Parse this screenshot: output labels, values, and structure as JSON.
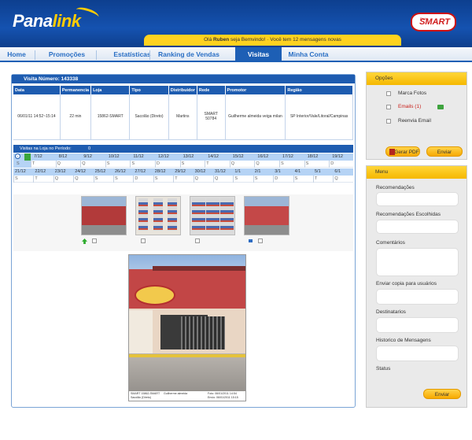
{
  "header": {
    "logo_main": "Pana",
    "logo_accent": "link",
    "brand_small": "Rede",
    "brand_name": "SMART",
    "welcome_prefix": "Olá ",
    "welcome_user": "Ruben",
    "welcome_suffix": " seja Bemvindo! · Você tem 12 mensagens novas"
  },
  "nav": [
    {
      "label": "Home"
    },
    {
      "label": "Promoções"
    },
    {
      "label": "Estatísticas"
    },
    {
      "label": "Ranking de Vendas"
    },
    {
      "label": "Visitas",
      "active": true
    },
    {
      "label": "Minha Conta"
    }
  ],
  "visit": {
    "title": "Visita Número: 143338",
    "columns": [
      "Data",
      "Permanencia",
      "Loja",
      "Tipo",
      "Distribuidor",
      "Rede",
      "Promotor",
      "Região"
    ],
    "row": [
      "06/01/11 14:52~15:14",
      "22 min",
      "15862-SMART",
      "Sacolão (Direto)",
      "Martins",
      "SMART 50784",
      "Guilherme almeida veiga milan",
      "SP Interior/Vale/Litoral/Campinas"
    ]
  },
  "calendar": {
    "label": "Visitas na Loja no Período:",
    "count": "0",
    "row1_dates": [
      "7/12",
      "8/12",
      "9/12",
      "10/12",
      "11/12",
      "12/12",
      "13/12",
      "14/12",
      "15/12",
      "16/12",
      "17/12",
      "18/12",
      "19/12"
    ],
    "row1_days": [
      "T",
      "Q",
      "Q",
      "S",
      "S",
      "D",
      "S",
      "T",
      "Q",
      "Q",
      "S",
      "S",
      "D"
    ],
    "row2_dates": [
      "21/12",
      "22/12",
      "23/12",
      "24/12",
      "25/12",
      "26/12",
      "27/12",
      "28/12",
      "29/12",
      "30/12",
      "31/12",
      "1/1",
      "2/1",
      "3/1",
      "4/1",
      "5/1",
      "6/1"
    ],
    "row2_days": [
      "S",
      "T",
      "Q",
      "Q",
      "S",
      "S",
      "D",
      "S",
      "T",
      "Q",
      "Q",
      "S",
      "S",
      "D",
      "S",
      "T",
      "Q"
    ],
    "first_day": "S"
  },
  "photo_caption": {
    "left1": "SMART 15862-SMART",
    "left2": "Sacolão (Direto)",
    "mid": "Guilherme almeida",
    "right1": "Foto: 06/01/2011 14:54",
    "right2": "Envio: 06/01/2011 15:15"
  },
  "options": {
    "title": "Opções",
    "items": [
      {
        "label": "Marca Fotos"
      },
      {
        "label": "Emails (1)",
        "color": "#c8201a"
      },
      {
        "label": "Reenvia Email"
      }
    ],
    "pdf_button": "Gerar PDF",
    "send_button": "Enviar"
  },
  "menu": {
    "title": "Menu",
    "fields": [
      {
        "label": "Recomendações"
      },
      {
        "label": "Recomendações Escolhidas"
      },
      {
        "label": "Comentários"
      },
      {
        "label": "Enviar copia para usuários"
      },
      {
        "label": "Destinatarios"
      },
      {
        "label": "Historico de Mensagens"
      },
      {
        "label": "Status"
      }
    ],
    "send_button": "Enviar"
  }
}
